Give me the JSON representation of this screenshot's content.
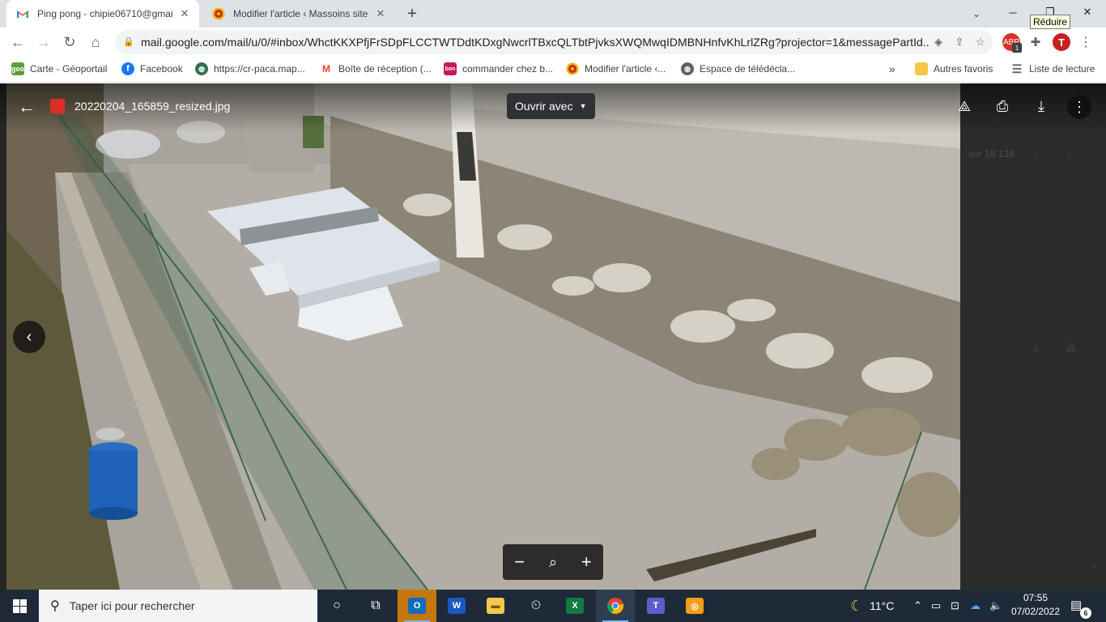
{
  "browser": {
    "tabs": [
      {
        "title": "Ping pong - chipie06710@gmail.",
        "favicon": "gmail-icon"
      },
      {
        "title": "Modifier l'article ‹ Massoins site",
        "favicon": "wordpress-site-icon"
      }
    ],
    "tooltip": "Réduire",
    "url": "mail.google.com/mail/u/0/#inbox/WhctKKXPfjFrSDpFLCCTWTDdtKDxgNwcrlTBxcQLTbtPjvksXWQMwqIDMBNHnfvKhLrlZRg?projector=1&messagePartId...",
    "extension_badge": "1",
    "bookmarks": [
      {
        "label": "Carte - Géoportail",
        "icon": "geo"
      },
      {
        "label": "Facebook",
        "icon": "f"
      },
      {
        "label": "https://cr-paca.map...",
        "icon": "globe"
      },
      {
        "label": "Boîte de réception (...",
        "icon": "M"
      },
      {
        "label": "commander chez b...",
        "icon": "bon"
      },
      {
        "label": "Modifier l'article ‹...",
        "icon": "wp"
      },
      {
        "label": "Espace de télédécla...",
        "icon": "globe"
      }
    ],
    "other_bookmarks": "Autres favoris",
    "reading_list": "Liste de lecture"
  },
  "viewer": {
    "file_name": "20220204_165859_resized.jpg",
    "open_with": "Ouvrir avec",
    "page_counter": "sur 18 138"
  },
  "taskbar": {
    "search_placeholder": "Taper ici pour rechercher",
    "weather": "11°C",
    "time": "07:55",
    "date": "07/02/2022",
    "notification_count": "6"
  },
  "colors": {
    "tabstrip": "#dee1e6",
    "omnibox": "#f1f3f4",
    "viewer_bg": "#262626",
    "taskbar": "#1e2a38"
  }
}
